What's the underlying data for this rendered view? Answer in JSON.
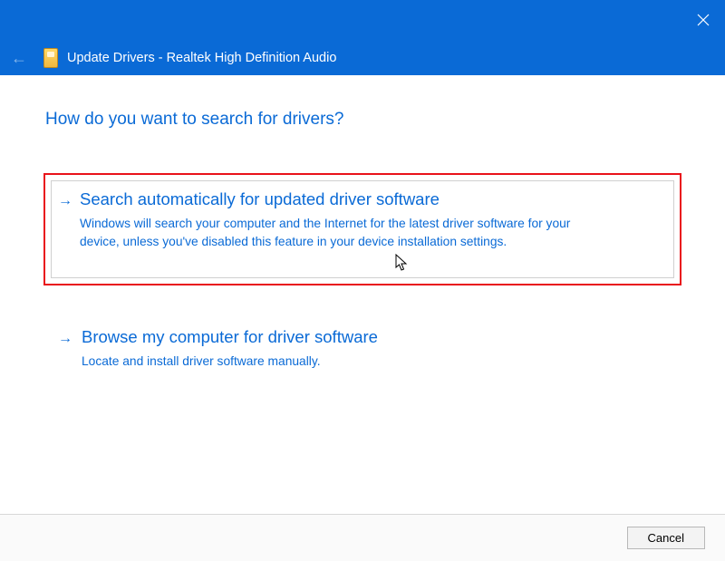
{
  "titlebar": {
    "close_tooltip": "Close"
  },
  "header": {
    "title": "Update Drivers - Realtek High Definition Audio"
  },
  "main": {
    "heading": "How do you want to search for drivers?",
    "options": [
      {
        "title": "Search automatically for updated driver software",
        "desc": "Windows will search your computer and the Internet for the latest driver software for your device, unless you've disabled this feature in your device installation settings.",
        "highlighted": true
      },
      {
        "title": "Browse my computer for driver software",
        "desc": "Locate and install driver software manually.",
        "highlighted": false
      }
    ]
  },
  "footer": {
    "cancel_label": "Cancel"
  }
}
